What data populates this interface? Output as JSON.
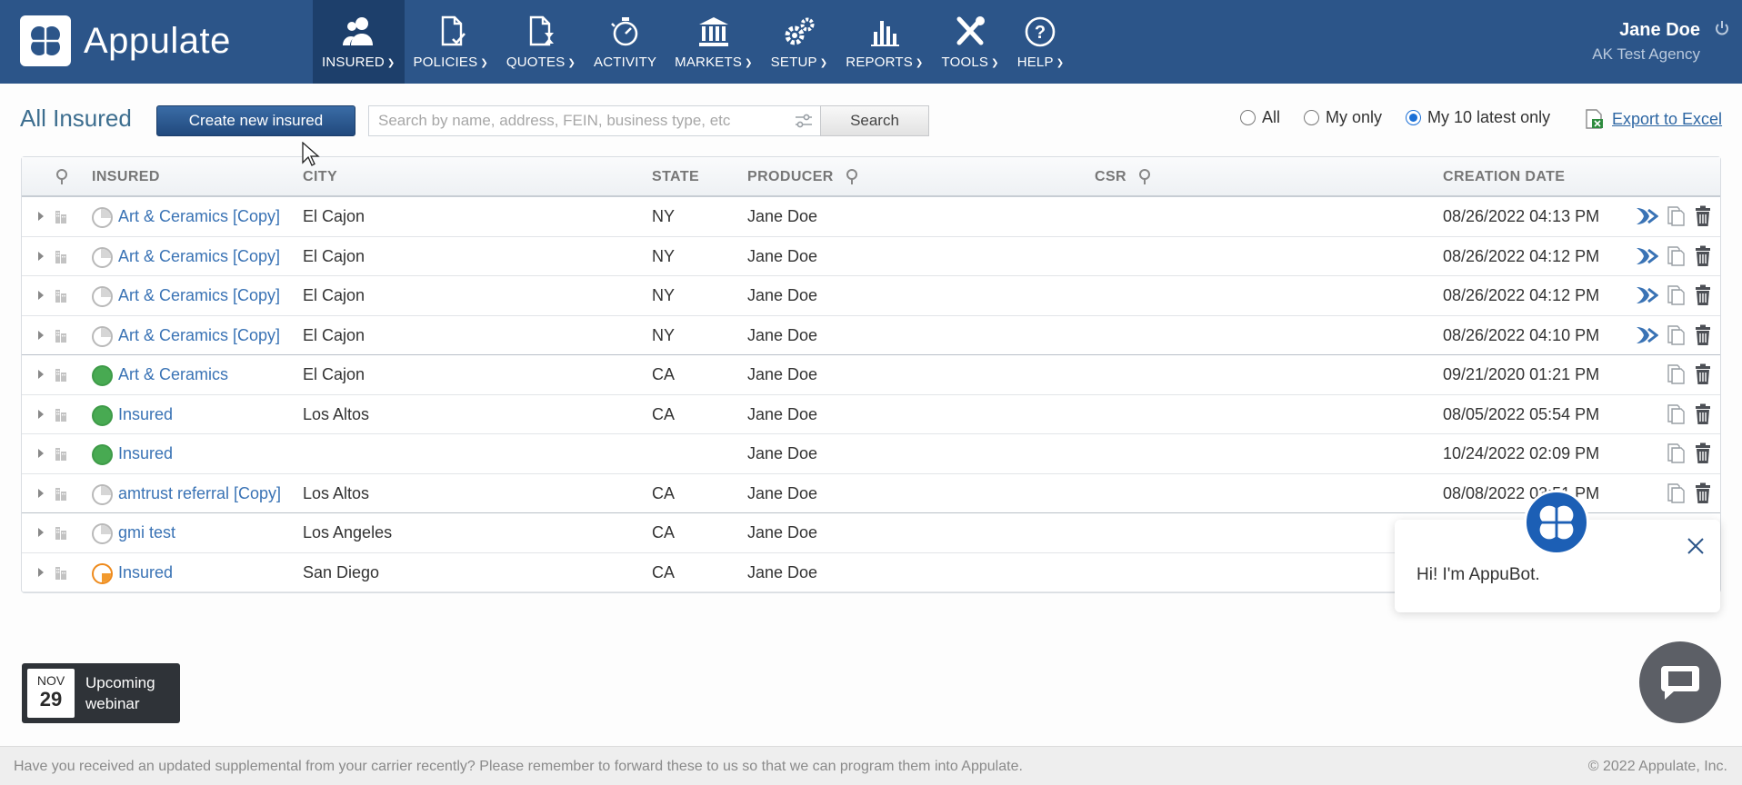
{
  "app": {
    "name": "Appulate"
  },
  "nav": [
    {
      "key": "insured",
      "label": "INSURED",
      "caret": true,
      "active": true
    },
    {
      "key": "policies",
      "label": "POLICIES",
      "caret": true
    },
    {
      "key": "quotes",
      "label": "QUOTES",
      "caret": true
    },
    {
      "key": "activity",
      "label": "ACTIVITY",
      "caret": false
    },
    {
      "key": "markets",
      "label": "MARKETS",
      "caret": true
    },
    {
      "key": "setup",
      "label": "SETUP",
      "caret": true
    },
    {
      "key": "reports",
      "label": "REPORTS",
      "caret": true
    },
    {
      "key": "tools",
      "label": "TOOLS",
      "caret": true
    },
    {
      "key": "help",
      "label": "HELP",
      "caret": true
    }
  ],
  "user": {
    "name": "Jane Doe",
    "agency": "AK Test Agency"
  },
  "page": {
    "title": "All Insured"
  },
  "toolbar": {
    "create_label": "Create new insured",
    "search_placeholder": "Search by name, address, FEIN, business type, etc",
    "search_value": "",
    "search_label": "Search",
    "radios": [
      {
        "label": "All",
        "checked": false
      },
      {
        "label": "My only",
        "checked": false
      },
      {
        "label": "My 10 latest only",
        "checked": true
      }
    ],
    "export_label": "Export to Excel"
  },
  "table": {
    "headers": {
      "insured": "INSURED",
      "city": "CITY",
      "state": "STATE",
      "producer": "PRODUCER",
      "csr": "CSR",
      "creation_date": "CREATION DATE"
    },
    "rows": [
      {
        "name": "Art & Ceramics [Copy]",
        "city": "El Cajon",
        "state": "NY",
        "producer": "Jane Doe",
        "csr": "",
        "date": "08/26/2022 04:13 PM",
        "status": "gray",
        "forward": true
      },
      {
        "name": "Art & Ceramics [Copy]",
        "city": "El Cajon",
        "state": "NY",
        "producer": "Jane Doe",
        "csr": "",
        "date": "08/26/2022 04:12 PM",
        "status": "gray",
        "forward": true
      },
      {
        "name": "Art & Ceramics [Copy]",
        "city": "El Cajon",
        "state": "NY",
        "producer": "Jane Doe",
        "csr": "",
        "date": "08/26/2022 04:12 PM",
        "status": "gray",
        "forward": true
      },
      {
        "name": "Art & Ceramics [Copy]",
        "city": "El Cajon",
        "state": "NY",
        "producer": "Jane Doe",
        "csr": "",
        "date": "08/26/2022 04:10 PM",
        "status": "gray",
        "forward": true
      },
      {
        "name": "Art & Ceramics",
        "city": "El Cajon",
        "state": "CA",
        "producer": "Jane Doe",
        "csr": "",
        "date": "09/21/2020 01:21 PM",
        "status": "green",
        "forward": false
      },
      {
        "name": "Insured",
        "city": "Los Altos",
        "state": "CA",
        "producer": "Jane Doe",
        "csr": "",
        "date": "08/05/2022 05:54 PM",
        "status": "green",
        "forward": false
      },
      {
        "name": "Insured",
        "city": "",
        "state": "",
        "producer": "Jane Doe",
        "csr": "",
        "date": "10/24/2022 02:09 PM",
        "status": "green",
        "forward": false
      },
      {
        "name": "amtrust referral [Copy]",
        "city": "Los Altos",
        "state": "CA",
        "producer": "Jane Doe",
        "csr": "",
        "date": "08/08/2022 03:51 PM",
        "status": "gray",
        "forward": false
      },
      {
        "name": "gmi test",
        "city": "Los Angeles",
        "state": "CA",
        "producer": "Jane Doe",
        "csr": "",
        "date": "",
        "status": "gray",
        "forward": false
      },
      {
        "name": "Insured",
        "city": "San Diego",
        "state": "CA",
        "producer": "Jane Doe",
        "csr": "",
        "date": "",
        "status": "orange",
        "forward": false
      }
    ]
  },
  "webinar": {
    "month": "NOV",
    "day": "29",
    "line1": "Upcoming",
    "line2": "webinar"
  },
  "bot": {
    "greeting": "Hi! I'm AppuBot."
  },
  "footer": {
    "message": "Have you received an updated supplemental from your carrier recently? Please remember to forward these to us so that we can program them into Appulate.",
    "copyright": "© 2022 Appulate, Inc."
  },
  "colors": {
    "header_bg": "#2c5589",
    "active_nav": "#1d3f6b",
    "link": "#3a73b5",
    "status_green": "#48aa52",
    "status_orange": "#ee8a1c"
  }
}
